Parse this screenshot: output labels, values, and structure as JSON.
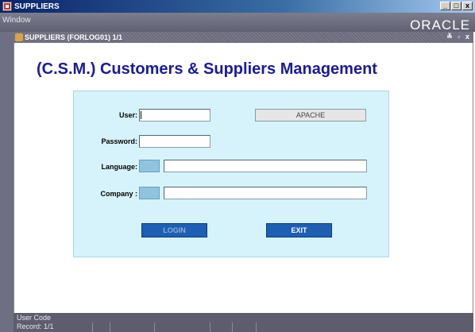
{
  "window": {
    "title": "SUPPLIERS",
    "controls": {
      "minimize": "_",
      "maximize": "□",
      "close": "x"
    }
  },
  "menubar": {
    "menu_window": "Window",
    "brand": "ORACLE"
  },
  "form_window": {
    "title": "SUPPLIERS (FORLOG01) 1/1",
    "controls": "≚ ▫ x"
  },
  "main": {
    "heading": "(C.S.M.) Customers & Suppliers Management",
    "login_form": {
      "user_label": "User:",
      "user_value": "",
      "display_value": "APACHE",
      "password_label": "Password:",
      "password_value": "",
      "language_label": "Language:",
      "language_code": "",
      "language_name": "",
      "company_label": "Company :",
      "company_code": "",
      "company_name": "",
      "login_button": "LOGIN",
      "exit_button": "EXIT"
    }
  },
  "statusbar": {
    "hint": "User Code",
    "record": "Record: 1/1"
  },
  "colors": {
    "heading": "#1a1a9e",
    "panel_bg": "#d6f3fb",
    "button_bg": "#1c5fb3"
  }
}
